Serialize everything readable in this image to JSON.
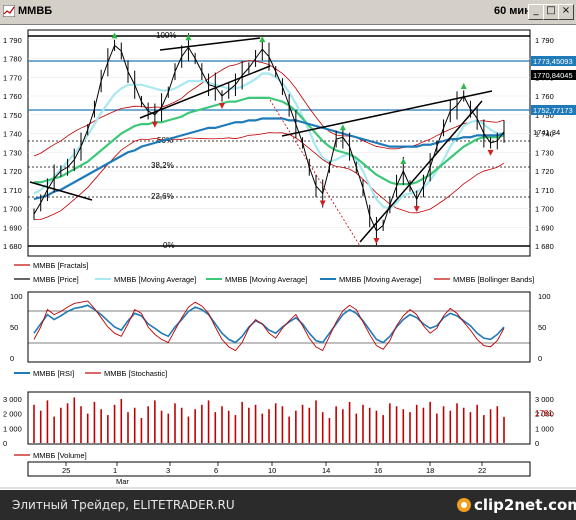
{
  "window": {
    "title": "MMBБ",
    "timeframe": "60 минут",
    "buttons": [
      "_",
      "□",
      "×"
    ]
  },
  "price_panel": {
    "y_ticks": [
      "1 790",
      "1 780",
      "1 770",
      "1 760",
      "1 750",
      "1 740",
      "1 730",
      "1 720",
      "1 710",
      "1 700",
      "1 690",
      "1 680"
    ],
    "price_labels": [
      "1773,45093",
      "1770,84045",
      "1752,77173",
      "1741,34"
    ],
    "fib_labels": [
      "100%",
      "50%",
      "38,2%",
      "23,6%",
      "0%"
    ],
    "legend": [
      {
        "label": "MMBБ [Fractals]",
        "color": "#c00000"
      },
      {
        "label": "MMBБ [Price]",
        "color": "#000000"
      },
      {
        "label": "MMBБ [Moving Average]",
        "color": "#a8e8f0"
      },
      {
        "label": "MMBБ [Moving Average]",
        "color": "#3cc878"
      },
      {
        "label": "MMBБ [Moving Average]",
        "color": "#1e7ab8"
      },
      {
        "label": "MMBБ [Bollinger Bands]",
        "color": "#c00000"
      }
    ]
  },
  "osc_panel": {
    "y_ticks": [
      "100",
      "50",
      "0"
    ],
    "legend": [
      {
        "label": "MMBБ [RSI]",
        "color": "#1e7ab8"
      },
      {
        "label": "MMBБ [Stochastic]",
        "color": "#c00000"
      }
    ]
  },
  "volume_panel": {
    "y_ticks": [
      "3 000",
      "2 000",
      "1 000",
      "0"
    ],
    "last_value": "1781",
    "legend": [
      {
        "label": "MMBБ [Volume]",
        "color": "#c00000"
      }
    ]
  },
  "x_axis": {
    "labels": [
      "25",
      "1",
      "3",
      "6",
      "10",
      "14",
      "16",
      "18",
      "22"
    ],
    "month": "Mar"
  },
  "footer": {
    "credit": "Элитный Трейдер, ELITETRADER.RU",
    "brand": "clip2net.com"
  },
  "chart_data": {
    "type": "line",
    "series": [
      {
        "name": "MMBБ [Price]",
        "values": [
          1697,
          1703,
          1710,
          1716,
          1720,
          1722,
          1726,
          1733,
          1742,
          1753,
          1768,
          1778,
          1787,
          1784,
          1773,
          1766,
          1757,
          1752,
          1750,
          1754,
          1762,
          1773,
          1781,
          1786,
          1780,
          1773,
          1766,
          1765,
          1760,
          1763,
          1766,
          1771,
          1775,
          1780,
          1785,
          1781,
          1773,
          1765,
          1755,
          1745,
          1735,
          1722,
          1712,
          1708,
          1722,
          1737,
          1738,
          1733,
          1722,
          1711,
          1696,
          1688,
          1691,
          1702,
          1712,
          1720,
          1712,
          1705,
          1712,
          1722,
          1733,
          1743,
          1752,
          1755,
          1760,
          1753,
          1748,
          1740,
          1735,
          1736,
          1741
        ]
      },
      {
        "name": "MMBБ [Moving Average]",
        "values": [
          1708,
          1710,
          1713,
          1717,
          1721,
          1725,
          1729,
          1734,
          1739,
          1745,
          1751,
          1756,
          1761,
          1764,
          1766,
          1766,
          1766,
          1765,
          1764,
          1763,
          1763,
          1764,
          1766,
          1768,
          1768,
          1768,
          1767,
          1766,
          1765,
          1764,
          1764,
          1765,
          1767,
          1769,
          1772,
          1772,
          1770,
          1767,
          1762,
          1756,
          1749,
          1741,
          1733,
          1727,
          1725,
          1726,
          1728,
          1729,
          1726,
          1720,
          1712,
          1705,
          1701,
          1700,
          1703,
          1707,
          1708,
          1709,
          1711,
          1715,
          1720,
          1726,
          1733,
          1738,
          1744,
          1746,
          1747,
          1745,
          1742,
          1740,
          1740
        ]
      },
      {
        "name": "MMBБ [Moving Average]",
        "values": [
          1714,
          1714,
          1715,
          1716,
          1717,
          1719,
          1721,
          1723,
          1725,
          1728,
          1731,
          1734,
          1737,
          1740,
          1742,
          1744,
          1745,
          1745,
          1746,
          1746,
          1747,
          1748,
          1749,
          1751,
          1752,
          1753,
          1754,
          1755,
          1756,
          1757,
          1757,
          1758,
          1759,
          1759,
          1759,
          1759,
          1758,
          1757,
          1755,
          1752,
          1748,
          1744,
          1740,
          1736,
          1733,
          1731,
          1730,
          1729,
          1727,
          1724,
          1721,
          1718,
          1716,
          1714,
          1713,
          1713,
          1713,
          1714,
          1716,
          1718,
          1721,
          1724,
          1727,
          1730,
          1733,
          1735,
          1737,
          1738,
          1738,
          1738,
          1739
        ]
      },
      {
        "name": "MMBБ [Moving Average]",
        "values": [
          1705,
          1706,
          1707,
          1709,
          1710,
          1712,
          1714,
          1716,
          1718,
          1720,
          1722,
          1724,
          1726,
          1728,
          1730,
          1731,
          1733,
          1734,
          1735,
          1736,
          1737,
          1738,
          1739,
          1740,
          1741,
          1742,
          1743,
          1743,
          1744,
          1745,
          1746,
          1746,
          1747,
          1747,
          1748,
          1748,
          1748,
          1748,
          1747,
          1747,
          1746,
          1745,
          1744,
          1743,
          1742,
          1741,
          1740,
          1739,
          1738,
          1737,
          1736,
          1735,
          1734,
          1733,
          1733,
          1733,
          1733,
          1733,
          1734,
          1734,
          1735,
          1736,
          1737,
          1737,
          1738,
          1738,
          1739,
          1739,
          1739,
          1739,
          1740
        ]
      }
    ],
    "ylim": [
      1680,
      1792
    ],
    "osc_series": [
      {
        "name": "MMBБ [RSI]",
        "values": [
          40,
          55,
          70,
          62,
          68,
          75,
          80,
          82,
          85,
          78,
          70,
          60,
          50,
          45,
          60,
          72,
          68,
          55,
          48,
          40,
          35,
          50,
          62,
          75,
          82,
          78,
          70,
          55,
          40,
          30,
          25,
          35,
          50,
          60,
          55,
          45,
          40,
          50,
          58,
          65,
          55,
          40,
          28,
          25,
          40,
          55,
          70,
          78,
          72,
          60,
          45,
          30,
          25,
          35,
          50,
          62,
          70,
          65,
          55,
          48,
          52,
          65,
          72,
          68,
          60,
          52,
          40,
          32,
          30,
          38,
          50
        ]
      },
      {
        "name": "MMBБ [Stochastic]",
        "values": [
          30,
          50,
          78,
          70,
          75,
          82,
          88,
          90,
          92,
          80,
          65,
          50,
          40,
          35,
          55,
          78,
          72,
          50,
          38,
          30,
          25,
          45,
          65,
          82,
          90,
          84,
          72,
          50,
          30,
          18,
          12,
          25,
          48,
          62,
          55,
          40,
          32,
          48,
          60,
          70,
          52,
          32,
          18,
          12,
          35,
          58,
          76,
          85,
          78,
          58,
          38,
          20,
          14,
          28,
          52,
          68,
          78,
          70,
          52,
          40,
          48,
          68,
          80,
          72,
          58,
          45,
          30,
          20,
          18,
          28,
          48
        ]
      }
    ],
    "osc_ylim": [
      0,
      100
    ],
    "volume": [
      2600,
      2200,
      2900,
      1800,
      2400,
      2700,
      3100,
      2500,
      2000,
      2800,
      2300,
      1900,
      2600,
      3000,
      2100,
      2400,
      1700,
      2500,
      2900,
      2200,
      2000,
      2700,
      2400,
      1800,
      2300,
      2600,
      2900,
      2100,
      2500,
      2200,
      1900,
      2800,
      2400,
      2600,
      2000,
      2300,
      2700,
      2500,
      1800,
      2200,
      2600,
      2400,
      2900,
      2100,
      1700,
      2500,
      2300,
      2800,
      2000,
      2600,
      2400,
      2200,
      1900,
      2700,
      2500,
      2300,
      2100,
      2600,
      2400,
      2800,
      2000,
      2500,
      2200,
      2700,
      2400,
      2100,
      2600,
      1900,
      2300,
      2500,
      1781
    ],
    "volume_ylim": [
      0,
      3200
    ]
  }
}
